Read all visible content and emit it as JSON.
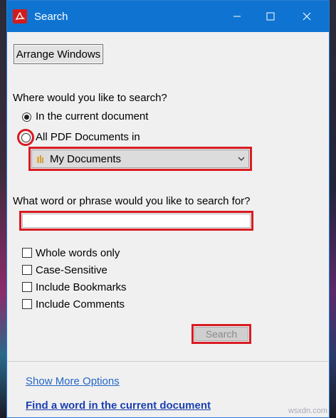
{
  "window": {
    "title": "Search",
    "controls": {
      "minimize": "minimize",
      "maximize": "maximize",
      "close": "close"
    }
  },
  "toolbar": {
    "arrange_label": "Arrange Windows"
  },
  "where": {
    "question": "Where would you like to search?",
    "options": [
      {
        "label": "In the current document",
        "selected": true
      },
      {
        "label": "All PDF Documents in",
        "selected": false
      }
    ],
    "location_value": "My Documents"
  },
  "what": {
    "question": "What word or phrase would you like to search for?",
    "input_value": ""
  },
  "options": [
    {
      "label": "Whole words only",
      "checked": false
    },
    {
      "label": "Case-Sensitive",
      "checked": false
    },
    {
      "label": "Include Bookmarks",
      "checked": false
    },
    {
      "label": "Include Comments",
      "checked": false
    }
  ],
  "search_button": "Search",
  "links": {
    "more_options": "Show More Options",
    "find_word": "Find a word in the current document"
  },
  "watermark": "wsxdn.com",
  "colors": {
    "titlebar": "#0f74d1",
    "highlight": "#d81b22",
    "link": "#2366c7"
  }
}
